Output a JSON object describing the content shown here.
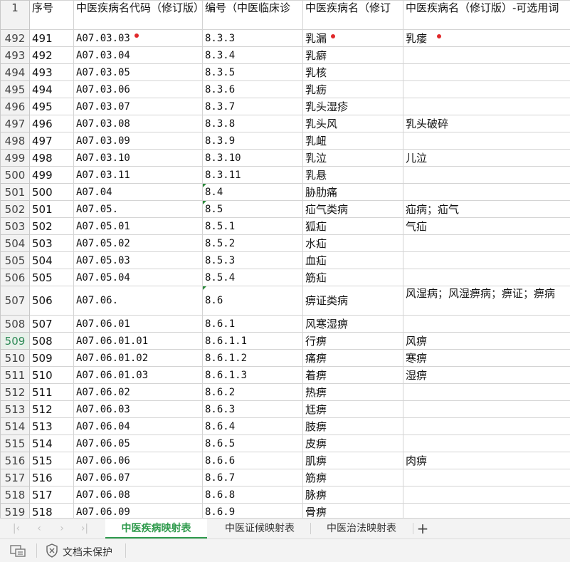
{
  "columns": [
    "序号",
    "中医疾病名代码（修订版）",
    "编号（中医临床诊",
    "中医疾病名（修订",
    "中医疾病名（修订版）-可选用词"
  ],
  "header_row_number": "1",
  "rows": [
    {
      "row": "492",
      "a": "491",
      "b": "A07.03.03",
      "c": "8.3.3",
      "d": "乳漏",
      "e": "乳瘘"
    },
    {
      "row": "493",
      "a": "492",
      "b": "A07.03.04",
      "c": "8.3.4",
      "d": "乳癖",
      "e": ""
    },
    {
      "row": "494",
      "a": "493",
      "b": "A07.03.05",
      "c": "8.3.5",
      "d": "乳核",
      "e": ""
    },
    {
      "row": "495",
      "a": "494",
      "b": "A07.03.06",
      "c": "8.3.6",
      "d": "乳疬",
      "e": ""
    },
    {
      "row": "496",
      "a": "495",
      "b": "A07.03.07",
      "c": "8.3.7",
      "d": "乳头湿疹",
      "e": ""
    },
    {
      "row": "497",
      "a": "496",
      "b": "A07.03.08",
      "c": "8.3.8",
      "d": "乳头风",
      "e": "乳头破碎"
    },
    {
      "row": "498",
      "a": "497",
      "b": "A07.03.09",
      "c": "8.3.9",
      "d": "乳衄",
      "e": ""
    },
    {
      "row": "499",
      "a": "498",
      "b": "A07.03.10",
      "c": "8.3.10",
      "d": "乳泣",
      "e": "儿泣"
    },
    {
      "row": "500",
      "a": "499",
      "b": "A07.03.11",
      "c": "8.3.11",
      "d": "乳悬",
      "e": ""
    },
    {
      "row": "501",
      "a": "500",
      "b": "A07.04",
      "c": "8.4",
      "d": "胁肋痛",
      "e": ""
    },
    {
      "row": "502",
      "a": "501",
      "b": "A07.05.",
      "c": "8.5",
      "d": "疝气类病",
      "e": "疝病；疝气"
    },
    {
      "row": "503",
      "a": "502",
      "b": "A07.05.01",
      "c": "8.5.1",
      "d": "狐疝",
      "e": "气疝"
    },
    {
      "row": "504",
      "a": "503",
      "b": "A07.05.02",
      "c": "8.5.2",
      "d": "水疝",
      "e": ""
    },
    {
      "row": "505",
      "a": "504",
      "b": "A07.05.03",
      "c": "8.5.3",
      "d": "血疝",
      "e": ""
    },
    {
      "row": "506",
      "a": "505",
      "b": "A07.05.04",
      "c": "8.5.4",
      "d": "筋疝",
      "e": ""
    },
    {
      "row": "507",
      "a": "506",
      "b": "A07.06.",
      "c": "8.6",
      "d": "痹证类病",
      "e": "风湿病；风湿痹病；痹证；痹病"
    },
    {
      "row": "508",
      "a": "507",
      "b": "A07.06.01",
      "c": "8.6.1",
      "d": "风寒湿痹",
      "e": ""
    },
    {
      "row": "509",
      "a": "508",
      "b": "A07.06.01.01",
      "c": "8.6.1.1",
      "d": "行痹",
      "e": "风痹"
    },
    {
      "row": "510",
      "a": "509",
      "b": "A07.06.01.02",
      "c": "8.6.1.2",
      "d": "痛痹",
      "e": "寒痹"
    },
    {
      "row": "511",
      "a": "510",
      "b": "A07.06.01.03",
      "c": "8.6.1.3",
      "d": "着痹",
      "e": "湿痹"
    },
    {
      "row": "512",
      "a": "511",
      "b": "A07.06.02",
      "c": "8.6.2",
      "d": "热痹",
      "e": ""
    },
    {
      "row": "513",
      "a": "512",
      "b": "A07.06.03",
      "c": "8.6.3",
      "d": "尪痹",
      "e": ""
    },
    {
      "row": "514",
      "a": "513",
      "b": "A07.06.04",
      "c": "8.6.4",
      "d": "肢痹",
      "e": ""
    },
    {
      "row": "515",
      "a": "514",
      "b": "A07.06.05",
      "c": "8.6.5",
      "d": "皮痹",
      "e": ""
    },
    {
      "row": "516",
      "a": "515",
      "b": "A07.06.06",
      "c": "8.6.6",
      "d": "肌痹",
      "e": "肉痹"
    },
    {
      "row": "517",
      "a": "516",
      "b": "A07.06.07",
      "c": "8.6.7",
      "d": "筋痹",
      "e": ""
    },
    {
      "row": "518",
      "a": "517",
      "b": "A07.06.08",
      "c": "8.6.8",
      "d": "脉痹",
      "e": ""
    },
    {
      "row": "519",
      "a": "518",
      "b": "A07.06.09",
      "c": "8.6.9",
      "d": "骨痹",
      "e": ""
    }
  ],
  "sheet_tabs": [
    {
      "label": "中医疾病映射表",
      "active": true
    },
    {
      "label": "中医证候映射表",
      "active": false
    },
    {
      "label": "中医治法映射表",
      "active": false
    }
  ],
  "status": {
    "protect_label": "文档未保护"
  },
  "colors": {
    "accent": "#2e9a4c",
    "marker": "#e0282a",
    "grid": "#d4d4d4"
  },
  "icons": [
    "first-sheet-icon",
    "prev-sheet-icon",
    "next-sheet-icon",
    "last-sheet-icon",
    "add-sheet-icon",
    "document-view-icon",
    "shield-icon"
  ]
}
